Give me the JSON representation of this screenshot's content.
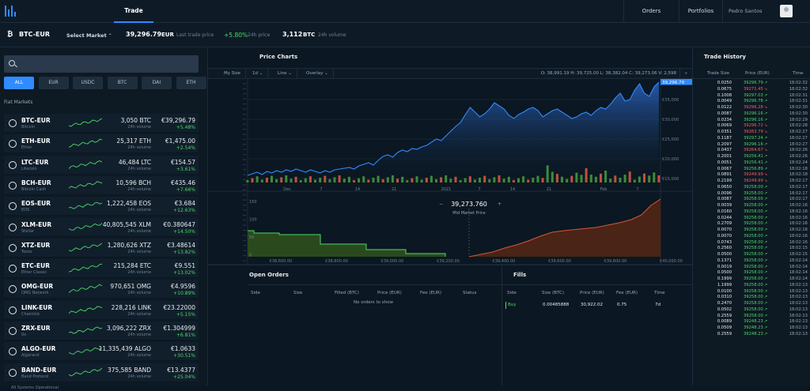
{
  "nav": {
    "trade": "Trade",
    "orders": "Orders",
    "portfolios": "Portfolios",
    "user": "Pedro Santos"
  },
  "ticker": {
    "pair": "BTC-EUR",
    "select": "Select Market",
    "last_price": "39,296.79",
    "currency": "EUR",
    "last_label": "Last trade price",
    "change": "+5.80%",
    "change_label": "24h price",
    "volume": "3,112",
    "volume_unit": "BTC",
    "volume_label": "24h volume"
  },
  "filters": [
    "ALL",
    "EUR",
    "USDC",
    "BTC",
    "DAI",
    "ETH"
  ],
  "flat_markets_label": "Fiat Markets",
  "markets": [
    {
      "pair": "BTC-EUR",
      "name": "Bitcoin",
      "vol": "3,050 BTC",
      "price": "€39,296.79",
      "change": "+5.48%",
      "icon": "bitcoin-icon"
    },
    {
      "pair": "ETH-EUR",
      "name": "Ether",
      "vol": "25,317 ETH",
      "price": "€1,475.00",
      "change": "+2.54%",
      "icon": "ether-icon"
    },
    {
      "pair": "LTC-EUR",
      "name": "Litecoin",
      "vol": "46,484 LTC",
      "price": "€154.57",
      "change": "+3.61%",
      "icon": "litecoin-icon"
    },
    {
      "pair": "BCH-EUR",
      "name": "Bitcoin Cash",
      "vol": "10,596 BCH",
      "price": "€435.46",
      "change": "+7.66%",
      "icon": "bitcoin-cash-icon"
    },
    {
      "pair": "EOS-EUR",
      "name": "EOS",
      "vol": "1,222,458 EOS",
      "price": "€3.684",
      "change": "+12.63%",
      "icon": "eos-icon"
    },
    {
      "pair": "XLM-EUR",
      "name": "Stellar",
      "vol": "40,805,545 XLM",
      "price": "€0.380647",
      "change": "+14.50%",
      "icon": "stellar-icon"
    },
    {
      "pair": "XTZ-EUR",
      "name": "Tezos",
      "vol": "1,280,626 XTZ",
      "price": "€3.48614",
      "change": "+13.82%",
      "icon": "tezos-icon"
    },
    {
      "pair": "ETC-EUR",
      "name": "Ether Classic",
      "vol": "215,284 ETC",
      "price": "€9.551",
      "change": "+13.02%",
      "icon": "ether-classic-icon"
    },
    {
      "pair": "OMG-EUR",
      "name": "OMG Network",
      "vol": "970,651 OMG",
      "price": "€4.9596",
      "change": "+10.89%",
      "icon": "omg-icon"
    },
    {
      "pair": "LINK-EUR",
      "name": "Chainlink",
      "vol": "228,216 LINK",
      "price": "€23.22000",
      "change": "+5.15%",
      "icon": "chainlink-icon"
    },
    {
      "pair": "ZRX-EUR",
      "name": "0x",
      "vol": "3,096,222 ZRX",
      "price": "€1.304999",
      "change": "+6.81%",
      "icon": "zrx-icon"
    },
    {
      "pair": "ALGO-EUR",
      "name": "Algorand",
      "vol": "11,335,439 ALGO",
      "price": "€1.0633",
      "change": "+30.51%",
      "icon": "algorand-icon"
    },
    {
      "pair": "BAND-EUR",
      "name": "Band Protocol",
      "vol": "375,585 BAND",
      "price": "€13.4377",
      "change": "+25.04%",
      "icon": "band-icon"
    }
  ],
  "chart": {
    "title": "Price Charts",
    "toolbar": {
      "size": "My Size",
      "interval": "1d",
      "type": "Line",
      "overlay": "Overlay"
    },
    "ohlc": "O: 38,991.19  H: 39,725.00  L: 38,382.04  C: 39,273.06  V: 2,598",
    "price_tag": "39,296.79",
    "y_labels": [
      "€35,000",
      "€30,000",
      "€25,000",
      "€20,000",
      "€15,000"
    ],
    "x_labels": [
      "Dec",
      "7",
      "14",
      "21",
      "2021",
      "7",
      "14",
      "21",
      "Feb",
      "7"
    ],
    "mid_price": "39,273.760",
    "mid_label": "Mid Market Price",
    "depth_x_labels": [
      "€38,600.00",
      "€38,800.00",
      "€39,000.00",
      "€39,200.00",
      "€39,400.00",
      "€39,600.00",
      "€39,800.00",
      "€40,000.00"
    ],
    "depth_y_labels": [
      "150",
      "100",
      "50",
      "0"
    ]
  },
  "open_orders": {
    "title": "Open Orders",
    "columns": [
      "Side",
      "Size",
      "Filled (BTC)",
      "Price (EUR)",
      "Fee (EUR)",
      "Status"
    ],
    "empty": "No orders to show"
  },
  "fills": {
    "title": "Fills",
    "columns": [
      "Side",
      "Size (BTC)",
      "Price (EUR)",
      "Fee (EUR)",
      "Time"
    ],
    "rows": [
      {
        "side": "Buy",
        "size": "0.00485888",
        "price": "30,922.02",
        "fee": "0.75",
        "time": "7d"
      }
    ]
  },
  "trade_history": {
    "title": "Trade History",
    "columns": [
      "Trade Size",
      "Price (EUR)",
      "Time"
    ],
    "rows": [
      [
        "0.0250",
        "39296.79",
        "18:02:32",
        "up"
      ],
      [
        "0.0675",
        "39271.45",
        "18:02:32",
        "down"
      ],
      [
        "0.1008",
        "39297.03",
        "18:02:31",
        "up"
      ],
      [
        "0.0049",
        "39296.78",
        "18:02:31",
        "up"
      ],
      [
        "0.0122",
        "39296.28",
        "18:02:30",
        "down"
      ],
      [
        "0.0087",
        "39296.16",
        "18:02:30",
        "up"
      ],
      [
        "0.0234",
        "39296.16",
        "18:02:29",
        "up"
      ],
      [
        "0.0069",
        "39296.72",
        "18:02:28",
        "down"
      ],
      [
        "0.0351",
        "39263.79",
        "18:02:27",
        "down"
      ],
      [
        "0.1187",
        "39297.24",
        "18:02:27",
        "up"
      ],
      [
        "0.2097",
        "39296.16",
        "18:02:27",
        "up"
      ],
      [
        "0.0437",
        "39264.67",
        "18:02:26",
        "down"
      ],
      [
        "0.2001",
        "39256.41",
        "18:02:26",
        "up"
      ],
      [
        "0.0051",
        "39256.41",
        "18:02:24",
        "up"
      ],
      [
        "0.0067",
        "39256.89",
        "18:02:18",
        "up"
      ],
      [
        "0.0891",
        "39249.99",
        "18:02:18",
        "down"
      ],
      [
        "0.2199",
        "39249.99",
        "18:02:17",
        "down"
      ],
      [
        "0.0650",
        "39258.00",
        "18:02:17",
        "up"
      ],
      [
        "0.0096",
        "39258.00",
        "18:02:17",
        "up"
      ],
      [
        "0.0087",
        "39258.00",
        "18:02:17",
        "up"
      ],
      [
        "0.0039",
        "39258.00",
        "18:02:16",
        "up"
      ],
      [
        "0.0160",
        "39258.00",
        "18:02:16",
        "up"
      ],
      [
        "0.0244",
        "39258.00",
        "18:02:16",
        "up"
      ],
      [
        "0.2709",
        "39258.00",
        "18:02:16",
        "up"
      ],
      [
        "0.0070",
        "39258.00",
        "18:02:16",
        "up"
      ],
      [
        "0.0070",
        "39258.00",
        "18:02:16",
        "up"
      ],
      [
        "0.0743",
        "39258.00",
        "18:02:16",
        "up"
      ],
      [
        "0.2560",
        "39258.00",
        "18:02:15",
        "up"
      ],
      [
        "0.0500",
        "39258.00",
        "18:02:15",
        "up"
      ],
      [
        "0.1371",
        "39258.00",
        "18:02:14",
        "up"
      ],
      [
        "0.0019",
        "39258.00",
        "18:02:14",
        "up"
      ],
      [
        "0.0500",
        "39258.00",
        "18:02:14",
        "up"
      ],
      [
        "0.1999",
        "39258.00",
        "18:02:14",
        "up"
      ],
      [
        "1.1999",
        "39258.00",
        "18:02:13",
        "up"
      ],
      [
        "0.0100",
        "39258.00",
        "18:02:13",
        "up"
      ],
      [
        "0.0310",
        "39258.00",
        "18:02:13",
        "up"
      ],
      [
        "0.2470",
        "39258.00",
        "18:02:13",
        "up"
      ],
      [
        "0.0502",
        "39258.00",
        "18:02:13",
        "up"
      ],
      [
        "0.2559",
        "39258.00",
        "18:02:13",
        "up"
      ],
      [
        "0.0089",
        "39248.23",
        "18:02:13",
        "up"
      ],
      [
        "0.0509",
        "39248.23",
        "18:02:13",
        "up"
      ],
      [
        "0.2559",
        "39248.23",
        "18:02:13",
        "up"
      ]
    ]
  },
  "footer": "All Systems Operational"
}
